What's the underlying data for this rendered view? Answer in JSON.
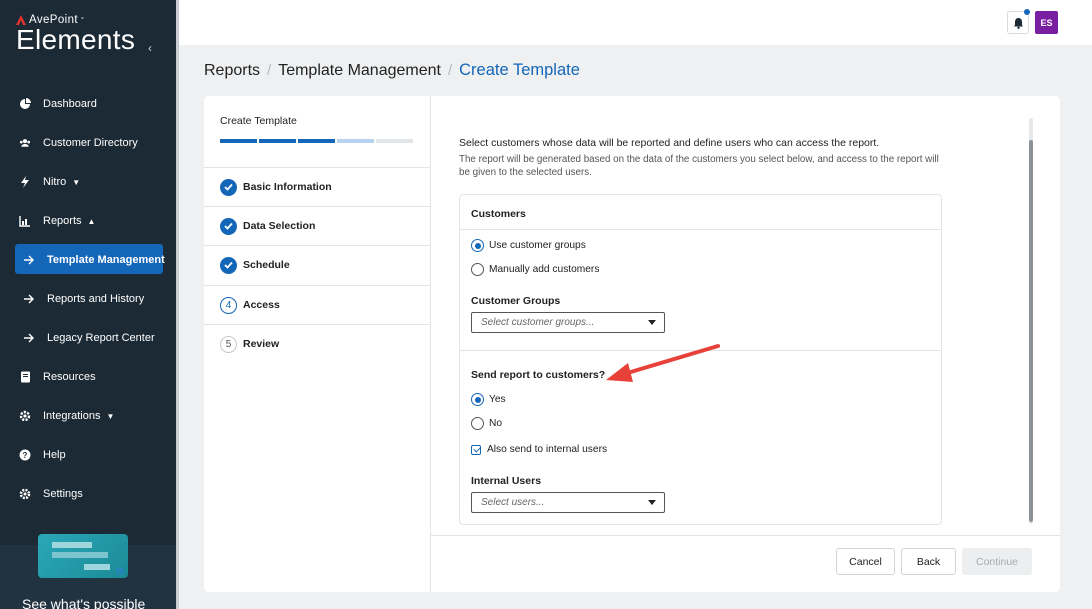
{
  "brand": {
    "company": "AvePoint",
    "product": "Elements"
  },
  "nav": {
    "items": [
      {
        "label": "Dashboard",
        "icon": "pie-chart-icon"
      },
      {
        "label": "Customer Directory",
        "icon": "users-icon"
      },
      {
        "label": "Nitro",
        "icon": "bolt-icon",
        "caret": "▼"
      },
      {
        "label": "Reports",
        "icon": "bar-chart-icon",
        "caret": "▲"
      },
      {
        "label": "Template Management",
        "icon": "arrow-right-icon",
        "active": true
      },
      {
        "label": "Reports and History",
        "icon": "arrow-right-icon"
      },
      {
        "label": "Legacy Report Center",
        "icon": "arrow-right-icon"
      },
      {
        "label": "Resources",
        "icon": "book-icon"
      },
      {
        "label": "Integrations",
        "icon": "gear-integration-icon",
        "caret": "▼"
      },
      {
        "label": "Help",
        "icon": "help-icon"
      },
      {
        "label": "Settings",
        "icon": "settings-icon"
      }
    ]
  },
  "promo": {
    "text": "See what's possible"
  },
  "topbar": {
    "avatar_initials": "ES",
    "avatar_color": "#7b1fa2",
    "notification_dot_color": "#1466b8"
  },
  "breadcrumb": {
    "level1": "Reports",
    "level2": "Template Management",
    "current": "Create Template",
    "separator": "/"
  },
  "wizard": {
    "title": "Create Template",
    "progress": {
      "completed_steps": 3,
      "total_steps": 5
    },
    "steps": [
      {
        "number": "1",
        "label": "Basic Information",
        "state": "done"
      },
      {
        "number": "2",
        "label": "Data Selection",
        "state": "done"
      },
      {
        "number": "3",
        "label": "Schedule",
        "state": "done"
      },
      {
        "number": "4",
        "label": "Access",
        "state": "current"
      },
      {
        "number": "5",
        "label": "Review",
        "state": "todo"
      }
    ]
  },
  "content": {
    "intro_heading": "Select customers whose data will be reported and define users who can access the report.",
    "intro_text": "The report will be generated based on the data of the customers you select below, and access to the report will be given to the selected users.",
    "customers": {
      "title": "Customers",
      "option_groups": "Use customer groups",
      "option_manual": "Manually add customers",
      "selected": "Use customer groups",
      "groups_label": "Customer Groups",
      "groups_placeholder": "Select customer groups..."
    },
    "send": {
      "question": "Send report to customers?",
      "yes": "Yes",
      "no": "No",
      "selected": "Yes",
      "also_internal": "Also send to internal users",
      "also_internal_checked": true,
      "internal_label": "Internal Users",
      "internal_placeholder": "Select users..."
    }
  },
  "footer": {
    "cancel": "Cancel",
    "back": "Back",
    "continue": "Continue"
  },
  "colors": {
    "accent": "#1466b8",
    "sidebar": "#1b2a35",
    "annotation_arrow": "#e8413a"
  }
}
